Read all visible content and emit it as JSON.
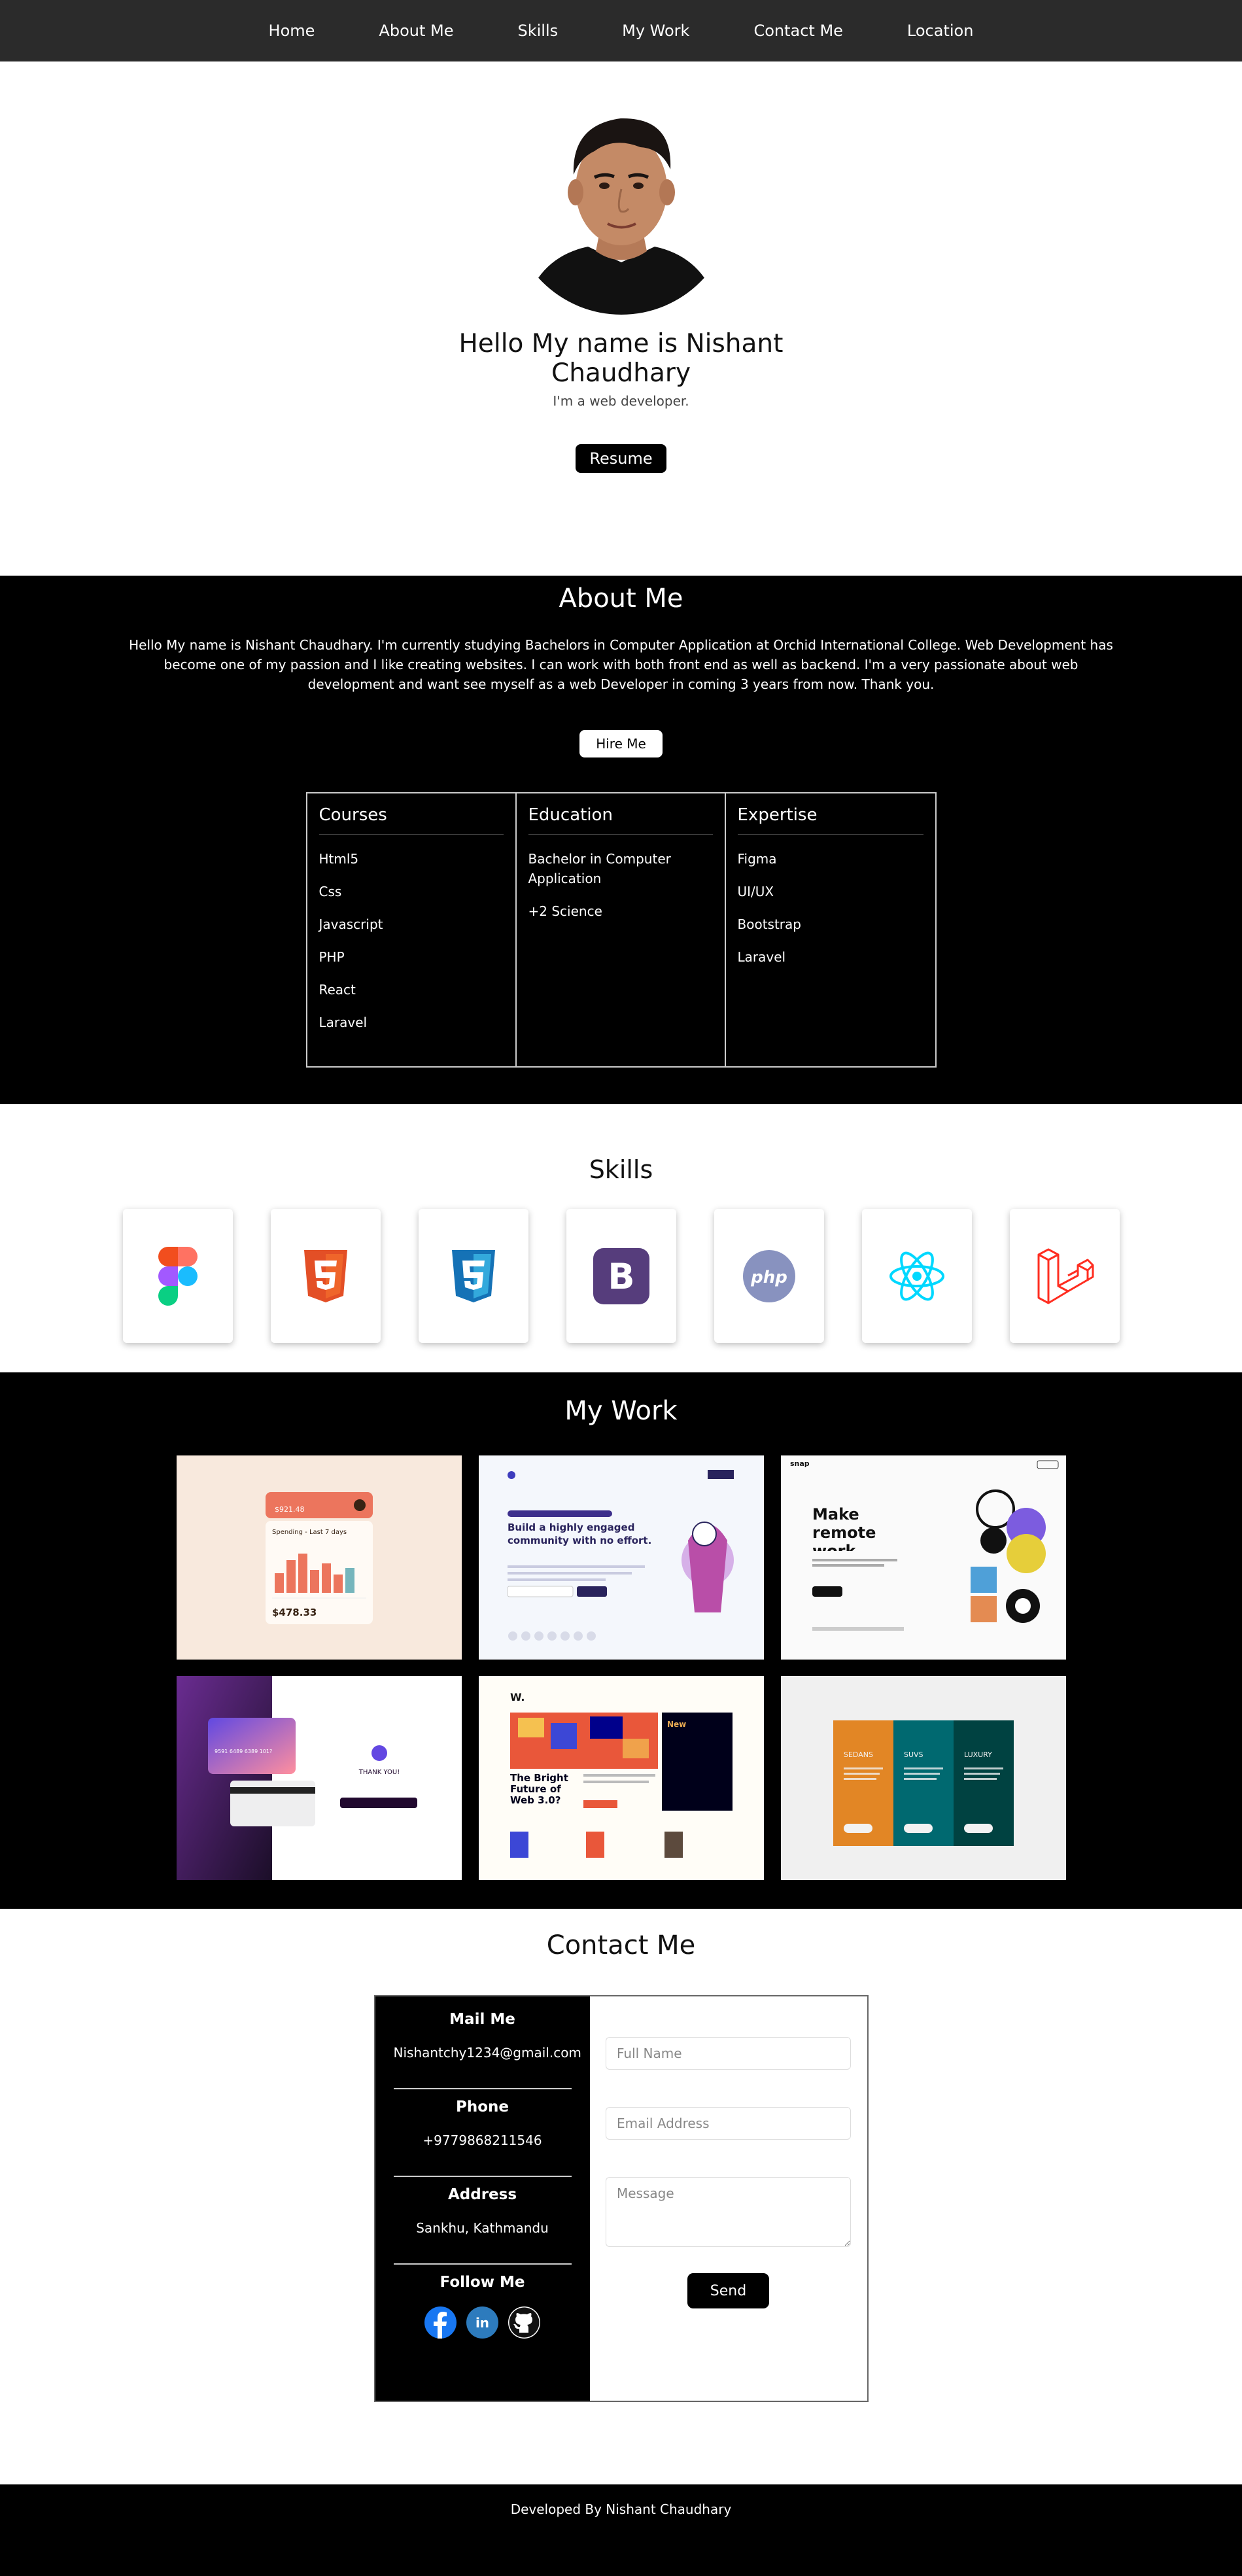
{
  "nav": {
    "items": [
      "Home",
      "About Me",
      "Skills",
      "My Work",
      "Contact Me",
      "Location"
    ]
  },
  "hero": {
    "heading": "Hello My name is Nishant Chaudhary",
    "tagline": "I'm a web developer.",
    "resume_label": "Resume"
  },
  "about": {
    "title": "About Me",
    "paragraph": "Hello My name is Nishant Chaudhary. I'm currently studying Bachelors in Computer Application at Orchid International College. Web Development has become one of my passion and I like creating websites. I can work with both front end as well as backend. I'm a very passionate about web development and want see myself as a web Developer in coming 3 years from now. Thank you.",
    "hire_label": "Hire Me",
    "columns": [
      {
        "title": "Courses",
        "items": [
          "Html5",
          "Css",
          "Javascript",
          "PHP",
          "React",
          "Laravel"
        ]
      },
      {
        "title": "Education",
        "items": [
          "Bachelor in Computer Application",
          "+2 Science"
        ]
      },
      {
        "title": "Expertise",
        "items": [
          "Figma",
          "UI/UX",
          "Bootstrap",
          "Laravel"
        ]
      }
    ]
  },
  "skills": {
    "title": "Skills",
    "icons": [
      "figma-icon",
      "html5-icon",
      "css3-icon",
      "bootstrap-icon",
      "php-icon",
      "react-icon",
      "laravel-icon"
    ]
  },
  "work": {
    "title": "My Work",
    "project1": {
      "label": "Spending - Last 7 days",
      "amount": "$478.33",
      "balance": "$921.48"
    },
    "project2": {
      "title": "Build a highly engaged community with no effort."
    },
    "project3": {
      "title": "Make remote work",
      "brand": "snap"
    },
    "project4": {
      "card_number": "9591 6489 6389 101?",
      "thanks": "THANK YOU!"
    },
    "project5": {
      "title": "The Bright Future of Web 3.0?",
      "badge": "New"
    },
    "project6": {
      "cols": [
        "SEDANS",
        "SUVS",
        "LUXURY"
      ]
    }
  },
  "contact": {
    "title": "Contact Me",
    "mail_label": "Mail Me",
    "mail_value": "Nishantchy1234@gmail.com",
    "phone_label": "Phone",
    "phone_value": "+9779868211546",
    "address_label": "Address",
    "address_value": "Sankhu, Kathmandu",
    "follow_label": "Follow Me",
    "fullname_placeholder": "Full Name",
    "email_placeholder": "Email Address",
    "message_placeholder": "Message",
    "send_label": "Send"
  },
  "footer": {
    "text": "Developed By Nishant Chaudhary"
  },
  "colors": {
    "nav_bg": "#2b2b2b",
    "dark_bg": "#000000",
    "facebook": "#1877f2",
    "linkedin": "#2d7bbd",
    "github": "#111111"
  }
}
